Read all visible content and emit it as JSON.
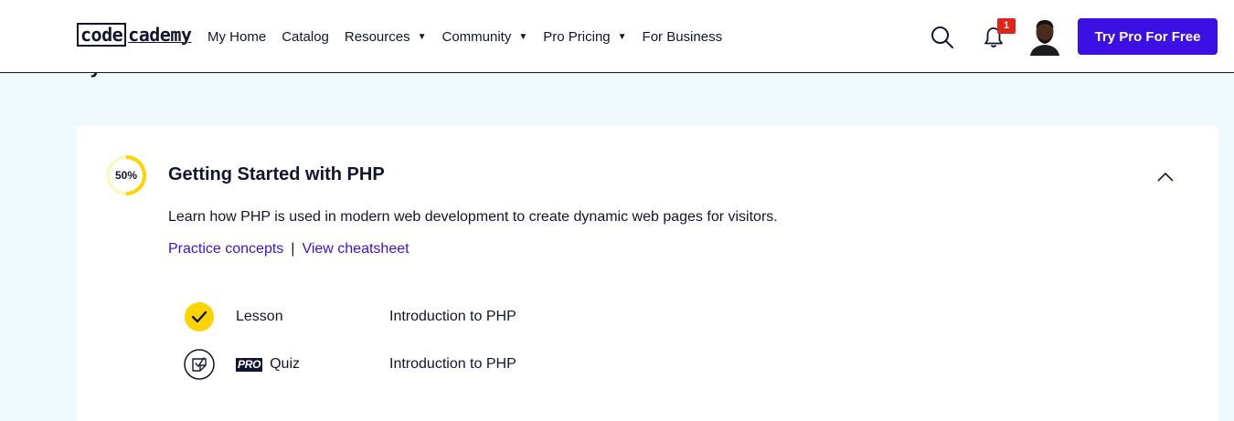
{
  "header": {
    "logo_part1": "code",
    "logo_part2": "cademy",
    "nav": [
      {
        "label": "My Home",
        "has_caret": false
      },
      {
        "label": "Catalog",
        "has_caret": false
      },
      {
        "label": "Resources",
        "has_caret": true
      },
      {
        "label": "Community",
        "has_caret": true
      },
      {
        "label": "Pro Pricing",
        "has_caret": true
      },
      {
        "label": "For Business",
        "has_caret": false
      }
    ],
    "caret_glyph": "▼",
    "notification_count": "1",
    "cta_label": "Try Pro For Free",
    "icons": [
      "search-icon",
      "bell-icon",
      "avatar"
    ],
    "accent_color": "#3a10e5",
    "badge_color": "#e2231a"
  },
  "syllabus": {
    "heading": "Syllabus"
  },
  "module": {
    "progress_label": "50%",
    "progress_fraction": 0.5,
    "progress_color": "#ffd300",
    "title": "Getting Started with PHP",
    "description": "Learn how PHP is used in modern web development to create dynamic web pages for visitors.",
    "link_practice": "Practice concepts",
    "link_separator": "|",
    "link_cheatsheet": "View cheatsheet",
    "items": [
      {
        "type": "Lesson",
        "pro": false,
        "name": "Introduction to PHP",
        "status": "completed"
      },
      {
        "type": "Quiz",
        "pro": true,
        "pro_label": "PRO",
        "name": "Introduction to PHP",
        "status": "not-started"
      }
    ]
  }
}
